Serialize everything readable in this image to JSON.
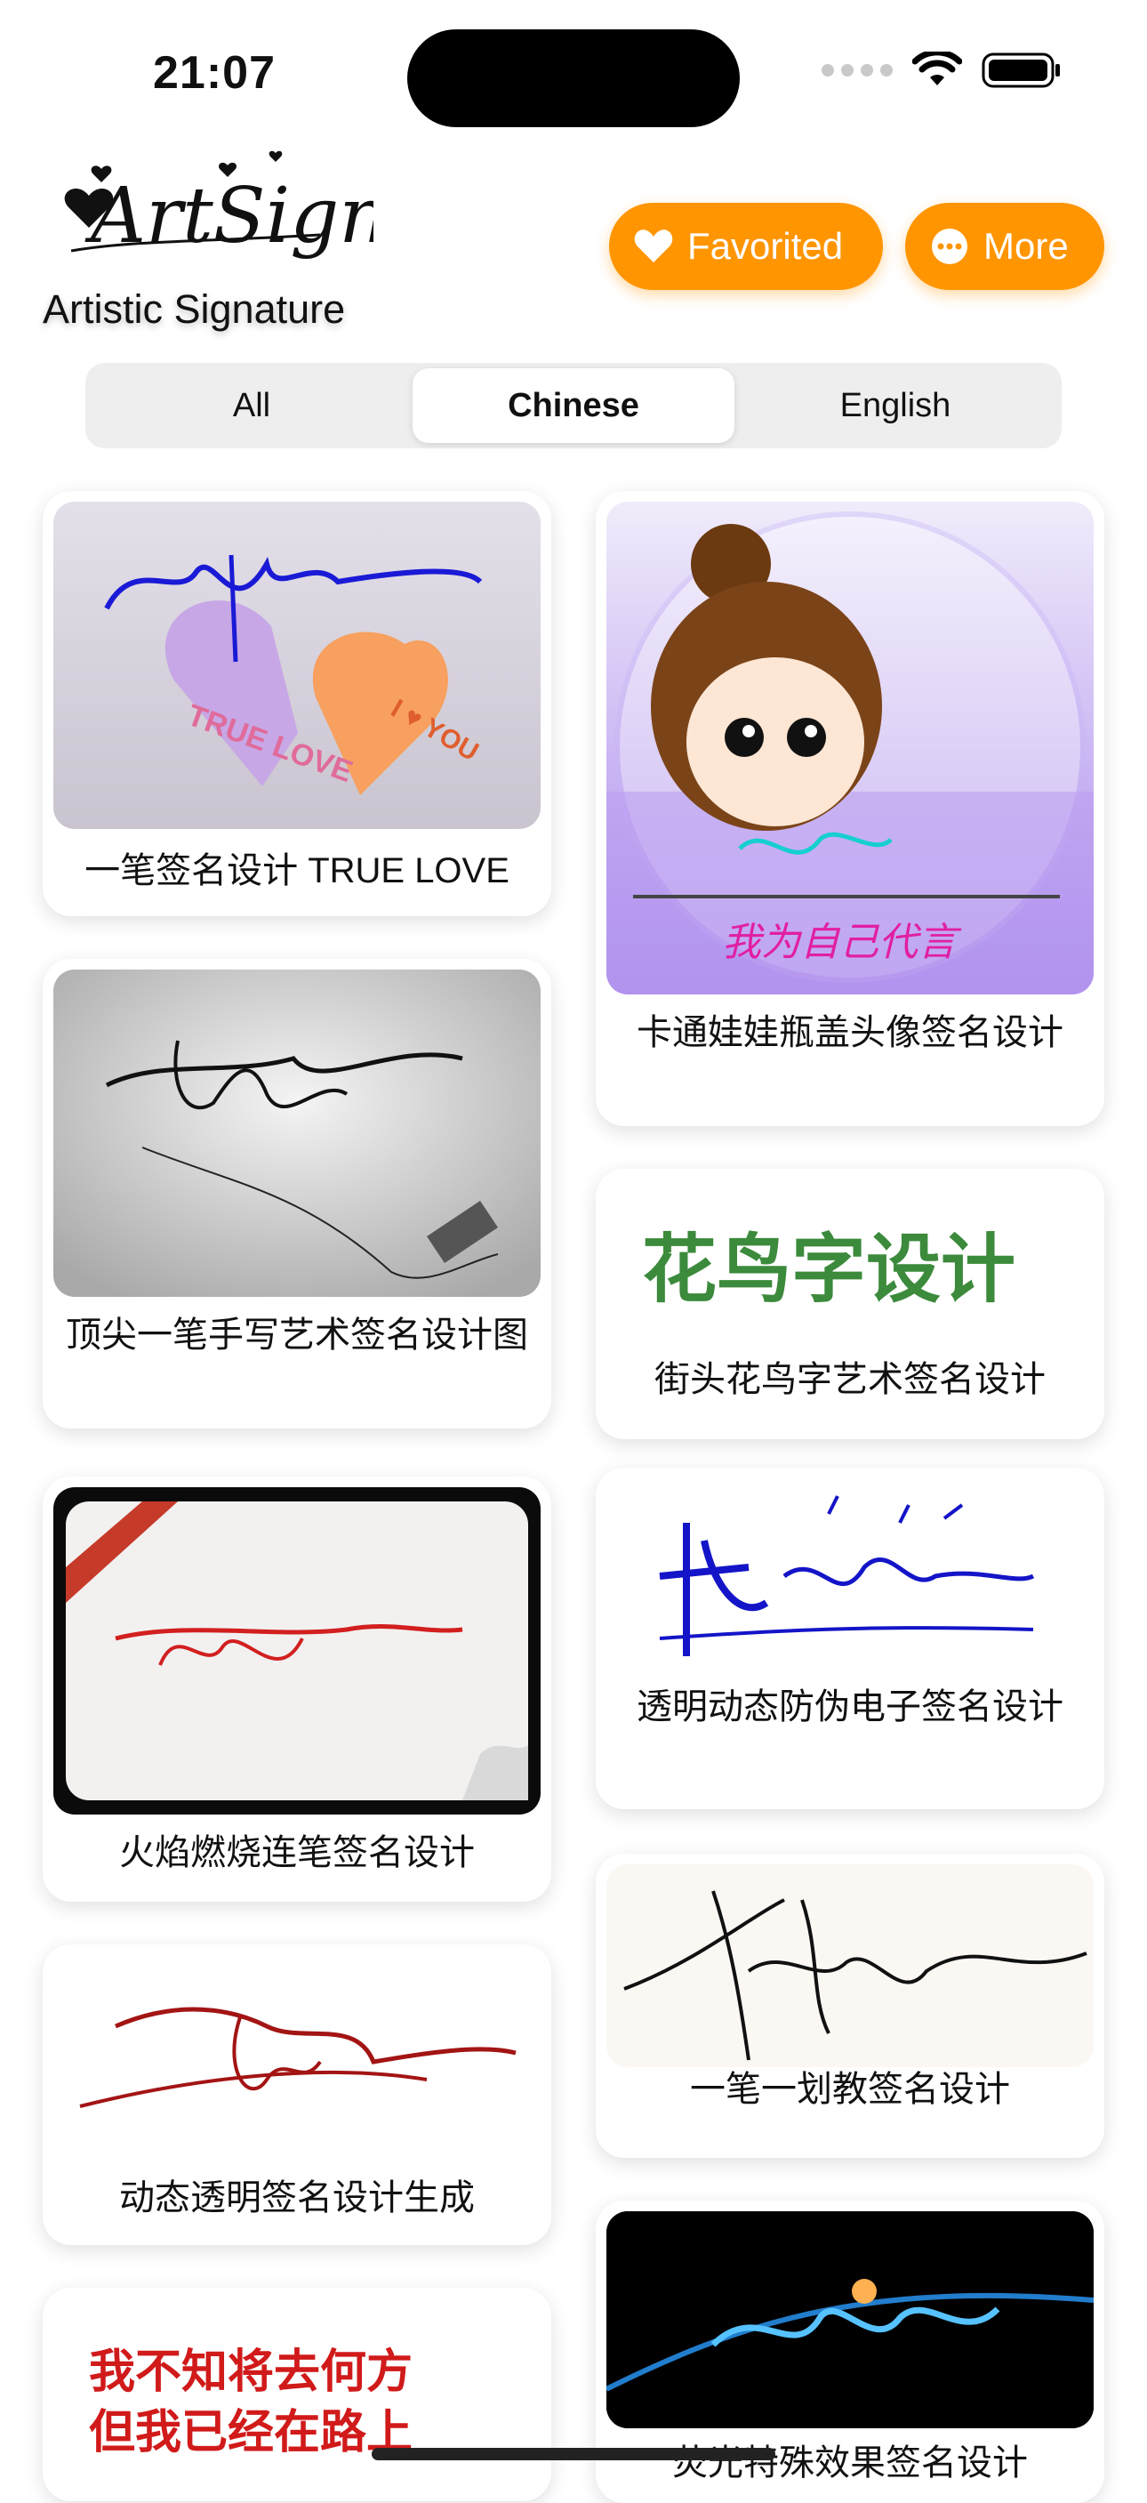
{
  "status_bar": {
    "time": "21:07"
  },
  "header": {
    "logo_text": "ArtSign",
    "subtitle": "Artistic Signature",
    "favorited_label": "Favorited",
    "more_label": "More",
    "accent": "#FF9500"
  },
  "segments": [
    "All",
    "Chinese",
    "English"
  ],
  "selected_segment": "Chinese",
  "cards": [
    {
      "caption": "一笔签名设计 TRUE LOVE",
      "thumb_text": "TRUE LOVE",
      "thumb_text2": "I ♥ YOU"
    },
    {
      "caption": "卡通娃娃瓶盖头像签名设计",
      "thumb_text": "我为自己代言"
    },
    {
      "caption": "顶尖一笔手写艺术签名设计图"
    },
    {
      "caption": "街头花鸟字艺术签名设计",
      "thumb_text": "花鸟字设计"
    },
    {
      "caption": "火焰燃烧连笔签名设计"
    },
    {
      "caption": "透明动态防伪电子签名设计"
    },
    {
      "caption": "动态透明签名设计生成"
    },
    {
      "caption": "一笔一划教签名设计"
    },
    {
      "caption": "",
      "thumb_text": "我不知将去何方",
      "thumb_text2": "但我已经在路上"
    },
    {
      "caption": "荧光特殊效果签名设计"
    }
  ]
}
